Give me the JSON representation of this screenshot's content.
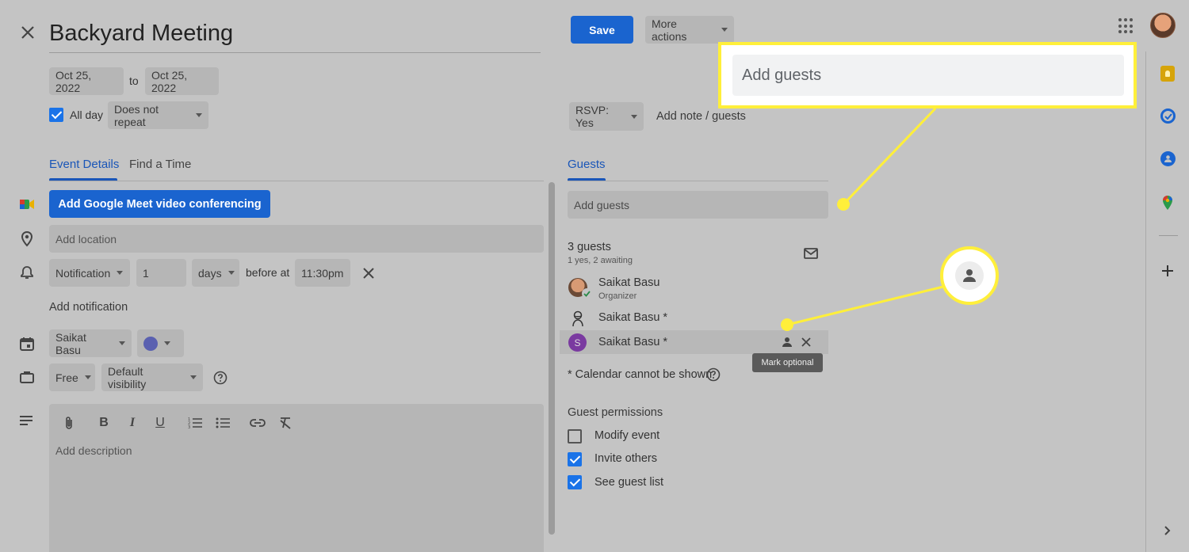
{
  "header": {
    "title": "Backyard Meeting",
    "save_label": "Save",
    "more_actions_label": "More actions"
  },
  "dates": {
    "start": "Oct 25, 2022",
    "to": "to",
    "end": "Oct 25, 2022",
    "all_day_label": "All day",
    "all_day_checked": true,
    "repeat": "Does not repeat"
  },
  "tabs": {
    "event_details": "Event Details",
    "find_time": "Find a Time",
    "guests": "Guests"
  },
  "event": {
    "meet_button": "Add Google Meet video conferencing",
    "location_placeholder": "Add location",
    "notification_type": "Notification",
    "notification_value": "1",
    "notification_unit": "days",
    "before_at": "before at",
    "notification_time": "11:30pm",
    "add_notification": "Add notification",
    "calendar_owner": "Saikat Basu",
    "availability": "Free",
    "visibility": "Default visibility",
    "description_placeholder": "Add description"
  },
  "rsvp": {
    "label": "RSVP: Yes",
    "add_note": "Add note / guests"
  },
  "guests": {
    "add_placeholder": "Add guests",
    "count": "3 guests",
    "summary": "1 yes, 2 awaiting",
    "list": [
      {
        "name": "Saikat Basu",
        "role": "Organizer"
      },
      {
        "name": "Saikat Basu *",
        "role": ""
      },
      {
        "name": "Saikat Basu *",
        "role": "",
        "avatar_letter": "S"
      }
    ],
    "tooltip": "Mark optional",
    "calendar_note": "* Calendar cannot be shown"
  },
  "permissions": {
    "heading": "Guest permissions",
    "items": [
      {
        "label": "Modify event",
        "checked": false
      },
      {
        "label": "Invite others",
        "checked": true
      },
      {
        "label": "See guest list",
        "checked": true
      }
    ]
  },
  "callout": {
    "add_guests_zoom": "Add guests"
  },
  "colors": {
    "accent": "#1a73e8",
    "highlight": "#ffef3a",
    "dimmed_bg": "#c4c4c4"
  }
}
